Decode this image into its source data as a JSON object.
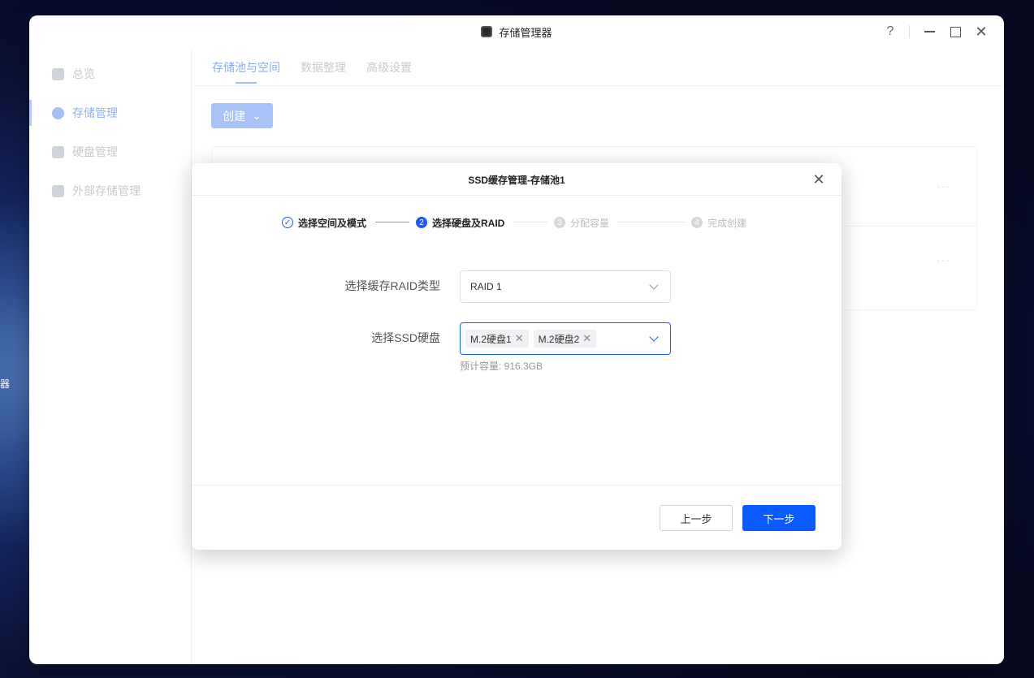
{
  "desktop": {
    "edge_label": "器"
  },
  "window": {
    "title": "存储管理器",
    "help_label": "?",
    "close_label": "✕"
  },
  "sidebar": {
    "items": [
      {
        "label": "总览",
        "icon": "overview-icon"
      },
      {
        "label": "存储管理",
        "icon": "database-icon",
        "active": true
      },
      {
        "label": "硬盘管理",
        "icon": "disk-icon"
      },
      {
        "label": "外部存储管理",
        "icon": "usb-drive-icon"
      }
    ]
  },
  "main": {
    "tabs": [
      {
        "label": "存储池与空间",
        "active": true
      },
      {
        "label": "数据整理"
      },
      {
        "label": "高级设置"
      }
    ],
    "create_button": "创建",
    "more_label": "···"
  },
  "dialog": {
    "title": "SSD缓存管理-存储池1",
    "close_label": "✕",
    "steps": [
      {
        "number": "✓",
        "label": "选择空间及模式",
        "state": "done"
      },
      {
        "number": "2",
        "label": "选择硬盘及RAID",
        "state": "current"
      },
      {
        "number": "3",
        "label": "分配容量",
        "state": "pending"
      },
      {
        "number": "4",
        "label": "完成创建",
        "state": "pending"
      }
    ],
    "raid_type": {
      "label": "选择缓存RAID类型",
      "value": "RAID 1"
    },
    "ssd_select": {
      "label": "选择SSD硬盘",
      "tags": [
        "M.2硬盘1",
        "M.2硬盘2"
      ],
      "tag_remove": "✕"
    },
    "estimated_capacity": "预计容量: 916.3GB",
    "prev_button": "上一步",
    "next_button": "下一步",
    "colors": {
      "primary": "#0a5bff",
      "step_line_done": "#6d98ff",
      "step_line_pending": "#e3e5e9"
    }
  }
}
